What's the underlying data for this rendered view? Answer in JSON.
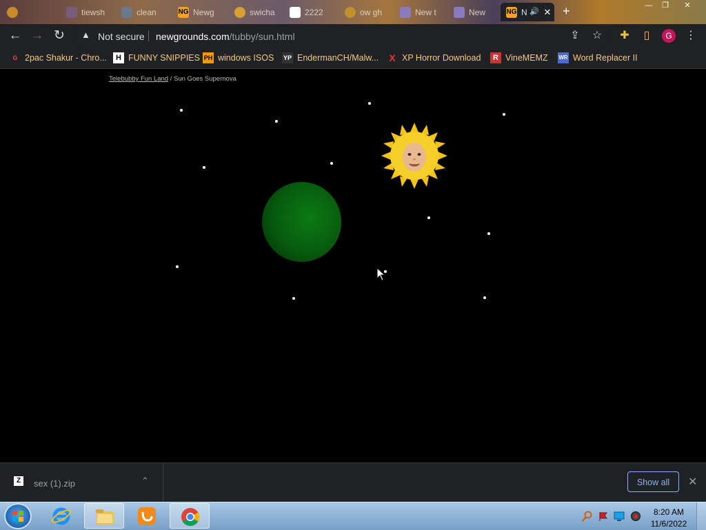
{
  "browser": {
    "tabs": [
      {
        "title": "",
        "favicon": "swirl-icon"
      },
      {
        "title": "tiewsh",
        "favicon": "page-icon"
      },
      {
        "title": "clean",
        "favicon": "page-icon"
      },
      {
        "title": "Newg",
        "favicon": "newgrounds-icon"
      },
      {
        "title": "swicha",
        "favicon": "swirl-icon"
      },
      {
        "title": "2222",
        "favicon": "white-square-icon"
      },
      {
        "title": "ow gh",
        "favicon": "swirl-icon"
      },
      {
        "title": "New t",
        "favicon": "page-icon"
      },
      {
        "title": "New",
        "favicon": "page-icon"
      },
      {
        "title": "N",
        "favicon": "newgrounds-icon",
        "active": true
      }
    ],
    "window_controls": {
      "minimize": "—",
      "maximize": "❐",
      "close": "✕"
    },
    "address": {
      "security_label": "Not secure",
      "url_domain": "newgrounds.com",
      "url_path": "/tubby/sun.html"
    },
    "profile_initial": "G",
    "bookmarks": [
      {
        "label": "2pac Shakur - Chro...",
        "icon": "G"
      },
      {
        "label": "FUNNY SNIPPIES",
        "icon": "H"
      },
      {
        "label": "windows ISOS",
        "icon": "PH"
      },
      {
        "label": "EndermanCH/Malw...",
        "icon": "YP"
      },
      {
        "label": "XP Horror Download",
        "icon": "X"
      },
      {
        "label": "VineMEMZ",
        "icon": "R"
      },
      {
        "label": "Word Replacer II",
        "icon": "WR"
      }
    ]
  },
  "page": {
    "breadcrumb_link": "Telebubby Fun Land",
    "breadcrumb_sep": " / ",
    "breadcrumb_current": "Sun Goes Supernova"
  },
  "downloads": {
    "file_name": "sex (1).zip",
    "file_icon": "Z",
    "chevron": "⌃",
    "show_all": "Show all",
    "close": "✕"
  },
  "taskbar": {
    "time": "8:20 AM",
    "date": "11/6/2022"
  }
}
